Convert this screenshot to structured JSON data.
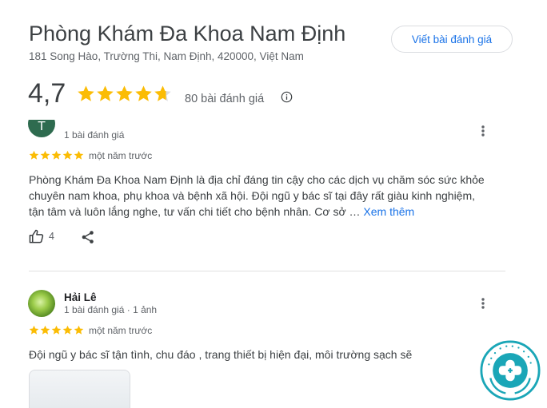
{
  "place": {
    "name": "Phòng Khám Đa Khoa Nam Định",
    "address": "181 Song Hào, Trường Thi, Nam Định, 420000, Việt Nam",
    "write_review_label": "Viết bài đánh giá",
    "rating": "4,7",
    "rating_value": 4.7,
    "review_count_label": "80 bài đánh giá"
  },
  "reviews": [
    {
      "reviewer_initial": "T",
      "reviewer_meta": "1 bài đánh giá",
      "stars": 5,
      "time": "một năm trước",
      "text": "Phòng Khám Đa Khoa Nam Định là địa chỉ đáng tin cậy cho các dịch vụ chăm sóc sức khỏe chuyên nam khoa, phụ khoa và bệnh xã hội. Đội ngũ y bác sĩ tại đây rất giàu kinh nghiệm, tận tâm và luôn lắng nghe, tư vấn chi tiết cho bệnh nhân. Cơ sở …",
      "more_label": "Xem thêm",
      "likes": "4"
    },
    {
      "reviewer_name": "Hải Lê",
      "reviewer_meta": "1 bài đánh giá · 1 ảnh",
      "stars": 5,
      "time": "một năm trước",
      "text": "Đội ngũ y bác sĩ tận tình, chu đáo , trang thiết bị hiện đại, môi trường sạch sẽ"
    }
  ],
  "colors": {
    "star": "#fbbc04",
    "star_empty": "#dadce0",
    "link": "#1a73e8",
    "logo": "#1aa6b7"
  }
}
